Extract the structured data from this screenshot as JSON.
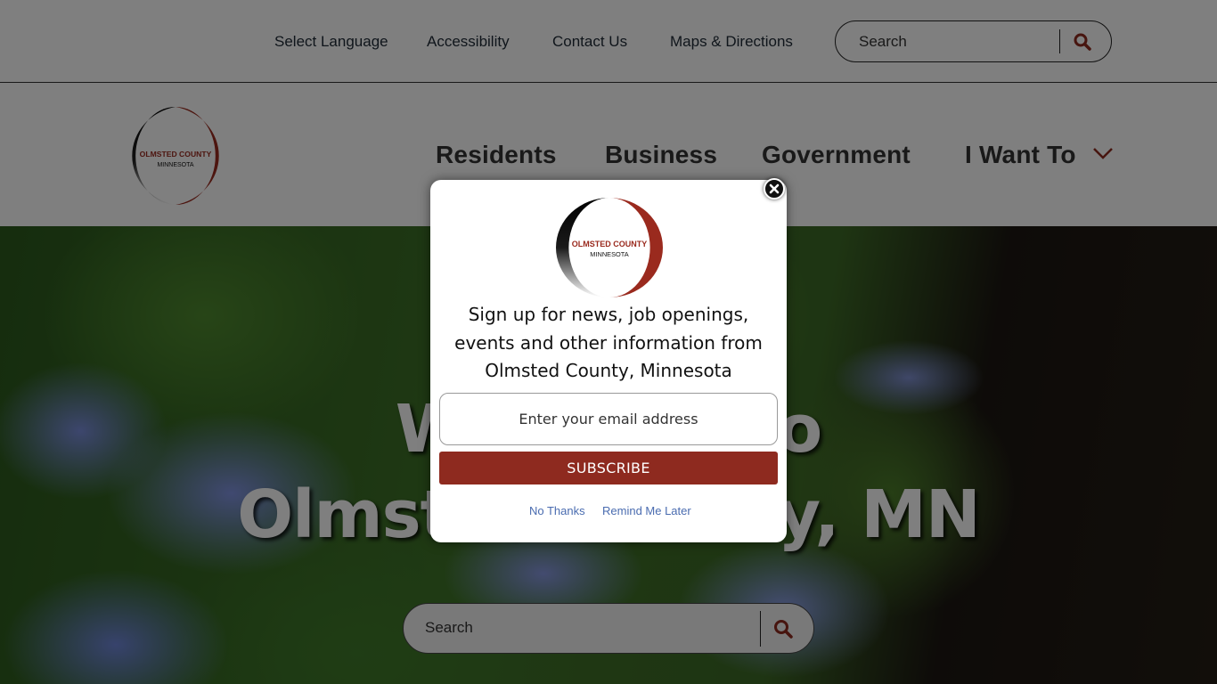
{
  "utility_nav": {
    "links": [
      {
        "label": "Select Language"
      },
      {
        "label": "Accessibility"
      },
      {
        "label": "Contact Us"
      },
      {
        "label": "Maps & Directions"
      }
    ],
    "search": {
      "placeholder": "Search",
      "icon": "search-icon"
    }
  },
  "header": {
    "logo": {
      "line1": "OLMSTED COUNTY",
      "line2": "MINNESOTA"
    },
    "nav": [
      {
        "label": "Residents"
      },
      {
        "label": "Business"
      },
      {
        "label": "Government"
      },
      {
        "label": "I Want To",
        "icon": "chevron-down-icon"
      }
    ]
  },
  "hero": {
    "title_line1": "Welcome to",
    "title_line2": "Olmsted County, MN",
    "search": {
      "placeholder": "Search",
      "icon": "search-icon"
    }
  },
  "modal": {
    "close_icon": "close-icon",
    "logo": {
      "line1": "OLMSTED COUNTY",
      "line2": "MINNESOTA"
    },
    "message": "Sign up for news, job openings, events and other information from Olmsted County, Minnesota",
    "email_placeholder": "Enter your email address",
    "subscribe_label": "SUBSCRIBE",
    "no_thanks_label": "No Thanks",
    "remind_later_label": "Remind Me Later"
  },
  "colors": {
    "brand_red": "#8e2a1f",
    "link_blue": "#4a6cb0",
    "overlay": "rgba(0,0,0,0.5)"
  }
}
